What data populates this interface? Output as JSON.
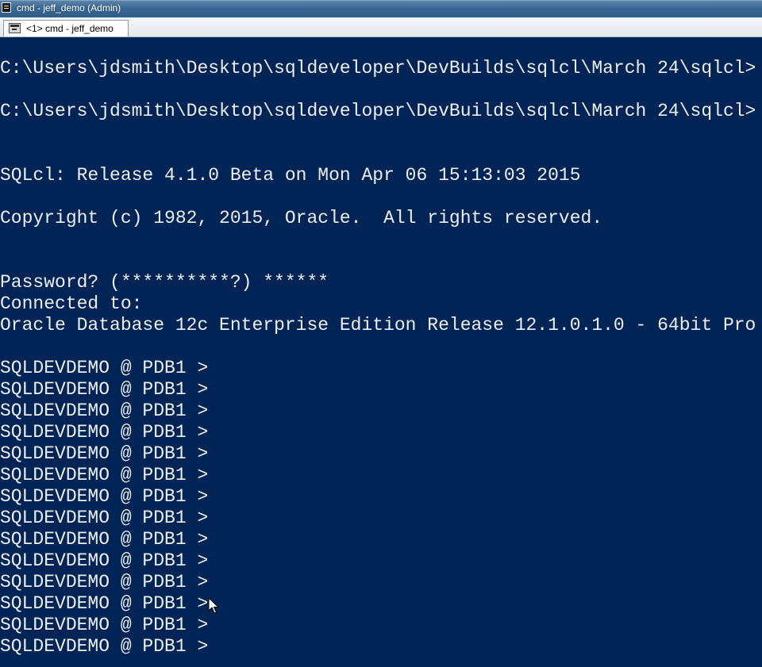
{
  "window": {
    "title": "cmd - jeff_demo (Admin)",
    "icon": "console-icon"
  },
  "tabs": [
    {
      "label": "<1> cmd - jeff_demo",
      "icon": "console-icon"
    }
  ],
  "terminal": {
    "colors": {
      "background": "#012456",
      "foreground": "#eeedf0"
    },
    "lines": [
      "C:\\Users\\jdsmith\\Desktop\\sqldeveloper\\DevBuilds\\sqlcl\\March 24\\sqlcl>",
      "C:\\Users\\jdsmith\\Desktop\\sqldeveloper\\DevBuilds\\sqlcl\\March 24\\sqlcl>",
      "SQLcl: Release 4.1.0 Beta on Mon Apr 06 15:13:03 2015",
      "Copyright (c) 1982, 2015, Oracle.  All rights reserved.",
      "Password? (**********?) ******",
      "Connected to:",
      "Oracle Database 12c Enterprise Edition Release 12.1.0.1.0 - 64bit Pro",
      "SQLDEVDEMO @ PDB1 >",
      "SQLDEVDEMO @ PDB1 >",
      "SQLDEVDEMO @ PDB1 >",
      "SQLDEVDEMO @ PDB1 >",
      "SQLDEVDEMO @ PDB1 >",
      "SQLDEVDEMO @ PDB1 >",
      "SQLDEVDEMO @ PDB1 >",
      "SQLDEVDEMO @ PDB1 >",
      "SQLDEVDEMO @ PDB1 >",
      "SQLDEVDEMO @ PDB1 >",
      "SQLDEVDEMO @ PDB1 >",
      "SQLDEVDEMO @ PDB1 >",
      "SQLDEVDEMO @ PDB1 >",
      "SQLDEVDEMO @ PDB1 >"
    ]
  },
  "cursor": {
    "icon": "mouse-pointer-icon"
  }
}
